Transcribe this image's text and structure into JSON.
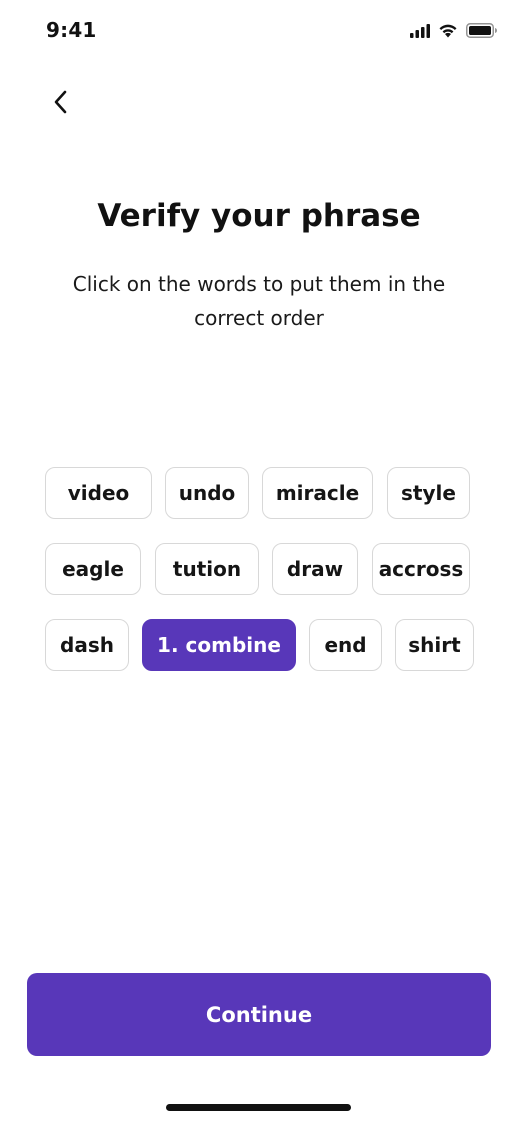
{
  "status_bar": {
    "time": "9:41",
    "icons": [
      "cellular-signal-icon",
      "wifi-icon",
      "battery-icon"
    ]
  },
  "nav": {
    "back_icon": "chevron-left-icon"
  },
  "header": {
    "title": "Verify your phrase",
    "subtitle": "Click on the words to put them in the correct order"
  },
  "words": [
    {
      "label": "video",
      "selected": false
    },
    {
      "label": "undo",
      "selected": false
    },
    {
      "label": "miracle",
      "selected": false
    },
    {
      "label": "style",
      "selected": false
    },
    {
      "label": "eagle",
      "selected": false
    },
    {
      "label": "tution",
      "selected": false
    },
    {
      "label": "draw",
      "selected": false
    },
    {
      "label": "accross",
      "selected": false
    },
    {
      "label": "dash",
      "selected": false
    },
    {
      "label": "1. combine",
      "selected": true
    },
    {
      "label": "end",
      "selected": false
    },
    {
      "label": "shirt",
      "selected": false
    }
  ],
  "footer": {
    "continue_label": "Continue"
  },
  "colors": {
    "accent": "#5837b9",
    "chip_border": "#d8d8d8",
    "text": "#111111",
    "background": "#ffffff"
  }
}
